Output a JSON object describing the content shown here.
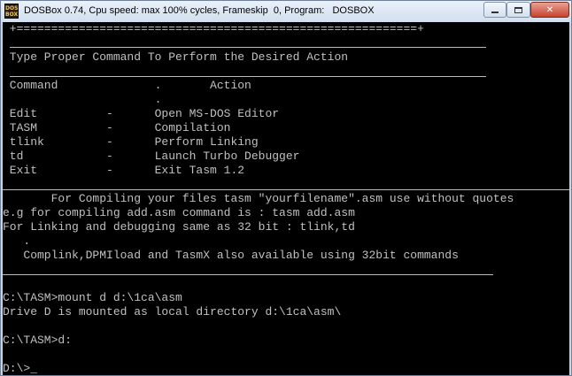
{
  "window": {
    "title": "DOSBox 0.74, Cpu speed: max 100% cycles, Frameskip  0, Program:   DOSBOX",
    "icon_text": "DOS BOX",
    "icon": "dosbox-app-icon",
    "controls": [
      "minimize-icon",
      "maximize-icon",
      "close-icon"
    ],
    "close_glyph": "✕"
  },
  "console": {
    "border_top": " +==========================================================+",
    "heading": " Type Proper Command To Perform the Desired Action",
    "columns_header": " Command              .       Action",
    "dot_line": "                      .",
    "commands": [
      " Edit          -      Open MS-DOS Editor",
      " TASM          -      Compilation",
      " tlink         -      Perform Linking",
      " td            -      Launch Turbo Debugger",
      " Exit          -      Exit Tasm 1.2"
    ],
    "notes": [
      "       For Compiling your files tasm \"yourfilename\".asm use without quotes",
      "e.g for compiling add.asm command is : tasm add.asm",
      "For Linking and debugging same as 32 bit : tlink,td",
      "   .",
      "   Complink,DPMIload and TasmX also available using 32bit commands"
    ],
    "session": [
      "C:\\TASM>mount d d:\\1ca\\asm",
      "Drive D is mounted as local directory d:\\1ca\\asm\\",
      "C:\\TASM>d:",
      "D:\\>_"
    ]
  }
}
